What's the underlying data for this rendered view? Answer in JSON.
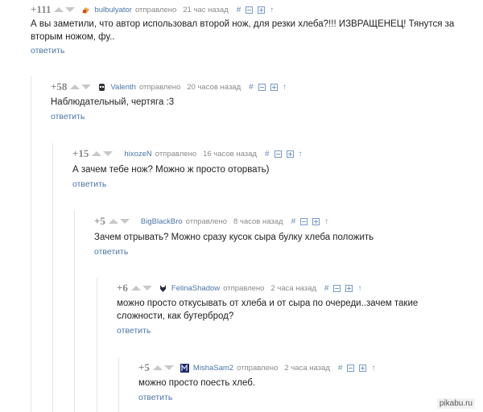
{
  "comments": [
    {
      "rating": "+111",
      "author": "bulbulyator",
      "sent": "отправлено",
      "time": "21 час назад",
      "text": "А вы заметили, что автор использовал второй нож, для резки хлеба?!!! ИЗВРАЩЕНЕЦ! Тянутся за вторым ножом, фу..",
      "reply": "ответить",
      "avatar_color": "#e8a23a"
    },
    {
      "rating": "+58",
      "author": "Valenth",
      "sent": "отправлено",
      "time": "20 часов назад",
      "text": "Наблюдательный, чертяга :3",
      "reply": "ответить",
      "avatar_color": "#333333"
    },
    {
      "rating": "+15",
      "author": "hixozeN",
      "sent": "отправлено",
      "time": "16 часов назад",
      "text": "А зачем тебе нож? Можно ж просто оторвать)",
      "reply": "ответить",
      "avatar_color": ""
    },
    {
      "rating": "+5",
      "author": "BigBlackBro",
      "sent": "отправлено",
      "time": "8 часов назад",
      "text": "Зачем отрывать? Можно сразу кусок сыра булку хлеба положить",
      "reply": "ответить",
      "avatar_color": ""
    },
    {
      "rating": "+6",
      "author": "FelinaShadow",
      "sent": "отправлено",
      "time": "2 часа назад",
      "text": "можно просто откусывать от хлеба и от сыра по очереди..зачем такие сложности, как бутерброд?",
      "reply": "ответить",
      "avatar_color": "#2a2a40"
    },
    {
      "rating": "+5",
      "author": "MishaSam2",
      "sent": "отправлено",
      "time": "2 часа назад",
      "text": "можно просто поесть хлеб.",
      "reply": "ответить",
      "avatar_color": "#1e2a6a"
    }
  ],
  "actions": {
    "hash": "#",
    "up": "↑"
  },
  "watermark": "pikabu.ru",
  "colors": {
    "link": "#4a76a8",
    "meta": "#8a8a8a",
    "rating": "#888888"
  }
}
